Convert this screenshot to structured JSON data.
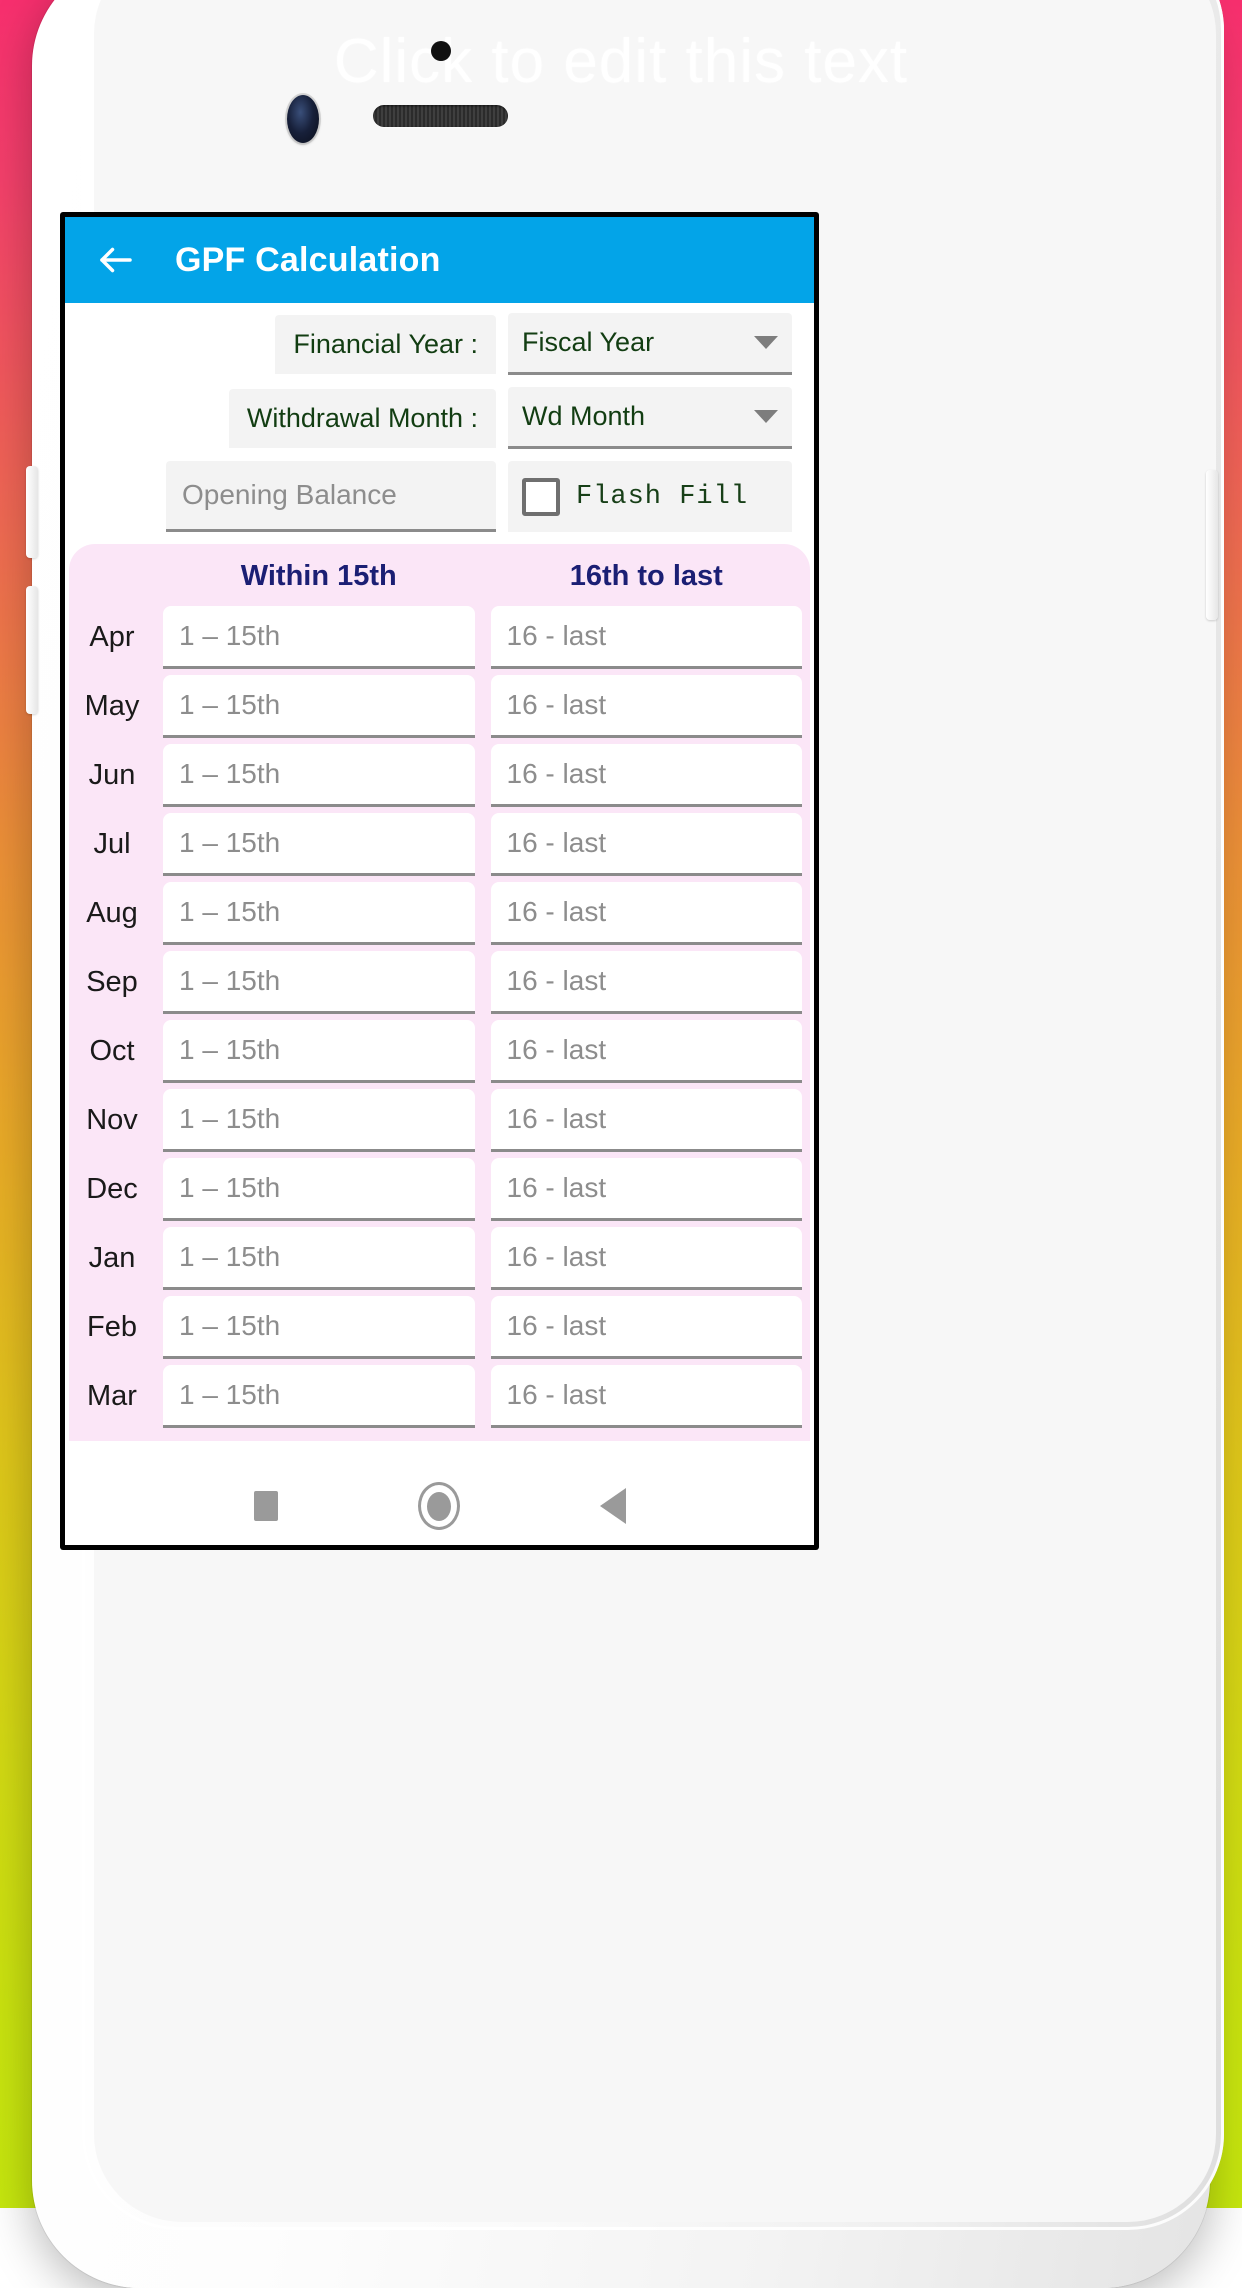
{
  "backdrop": {
    "gradient_top": "#f72f6e",
    "gradient_mid": "#ec8f38",
    "gradient_bottom": "#c6e70e"
  },
  "mockup": {
    "watermark_text": "Click to edit this text",
    "camera_icon": "camera-lens-icon",
    "speaker_icon": "earpiece-speaker-icon",
    "sensor_icon": "proximity-sensor-icon"
  },
  "appbar": {
    "back_icon": "back-arrow-icon",
    "title": "GPF Calculation",
    "background": "#03a4e8",
    "text_color": "#ffffff"
  },
  "form": {
    "financial_year": {
      "label": "Financial Year :",
      "dropdown_value": "Fiscal Year",
      "caret_icon": "chevron-down-icon"
    },
    "withdrawal_month": {
      "label": "Withdrawal Month :",
      "dropdown_value": "Wd Month",
      "caret_icon": "chevron-down-icon"
    },
    "opening_balance": {
      "placeholder": "Opening Balance",
      "value": ""
    },
    "flash_fill": {
      "label": "Flash Fill",
      "checked": false,
      "checkbox_icon": "checkbox-unchecked-icon"
    },
    "label_color": "#123d12"
  },
  "table": {
    "panel_background": "#fbe6f7",
    "header_color": "#1b1f74",
    "headers": [
      "Within 15th",
      "16th to last"
    ],
    "placeholder_first_half": "1 – 15th",
    "placeholder_second_half": "16 - last",
    "rows": [
      {
        "month": "Apr",
        "within_15th": "",
        "sixteenth_to_last": ""
      },
      {
        "month": "May",
        "within_15th": "",
        "sixteenth_to_last": ""
      },
      {
        "month": "Jun",
        "within_15th": "",
        "sixteenth_to_last": ""
      },
      {
        "month": "Jul",
        "within_15th": "",
        "sixteenth_to_last": ""
      },
      {
        "month": "Aug",
        "within_15th": "",
        "sixteenth_to_last": ""
      },
      {
        "month": "Sep",
        "within_15th": "",
        "sixteenth_to_last": ""
      },
      {
        "month": "Oct",
        "within_15th": "",
        "sixteenth_to_last": ""
      },
      {
        "month": "Nov",
        "within_15th": "",
        "sixteenth_to_last": ""
      },
      {
        "month": "Dec",
        "within_15th": "",
        "sixteenth_to_last": ""
      },
      {
        "month": "Jan",
        "within_15th": "",
        "sixteenth_to_last": ""
      },
      {
        "month": "Feb",
        "within_15th": "",
        "sixteenth_to_last": ""
      },
      {
        "month": "Mar",
        "within_15th": "",
        "sixteenth_to_last": ""
      }
    ]
  },
  "navbar": {
    "recents_icon": "square-recents-icon",
    "home_icon": "circle-home-icon",
    "back_icon": "triangle-back-icon"
  }
}
